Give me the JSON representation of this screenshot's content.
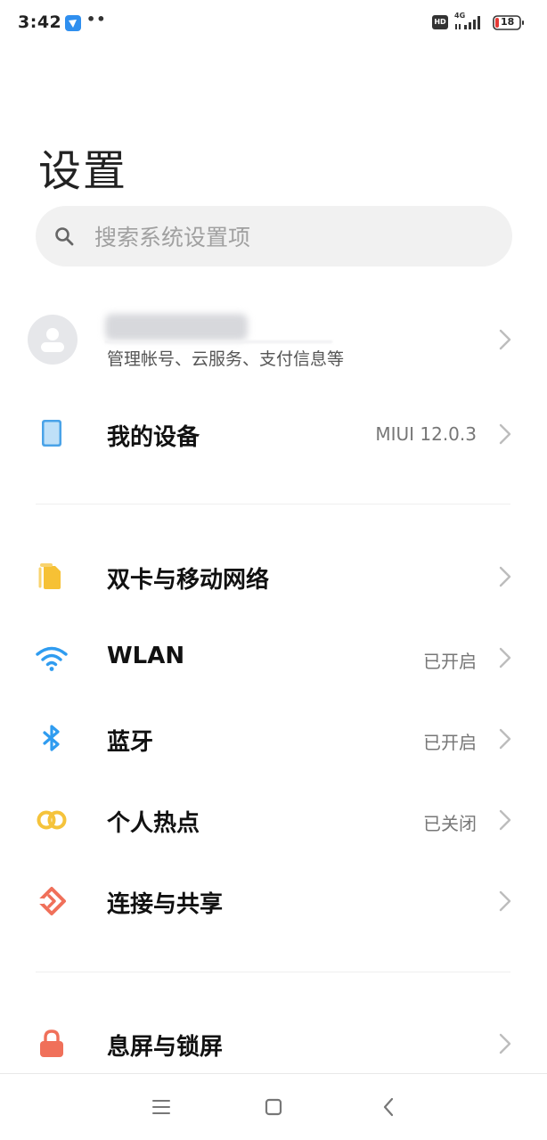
{
  "status_bar": {
    "time": "3:42",
    "app_icon": "feishu-icon",
    "dots": "••",
    "hd_label": "HD",
    "network_label": "4G",
    "battery_level": "18",
    "battery_color": "#e53935"
  },
  "page": {
    "title": "设置"
  },
  "search": {
    "placeholder": "搜索系统设置项",
    "icon": "search-icon"
  },
  "account": {
    "name_blurred": true,
    "subtitle": "管理帐号、云服务、支付信息等"
  },
  "groups": [
    {
      "items": [
        {
          "id": "my-device",
          "label": "我的设备",
          "value": "MIUI 12.0.3",
          "icon": "tablet-icon",
          "icon_color": "#4aa3e8"
        }
      ]
    },
    {
      "items": [
        {
          "id": "sim-network",
          "label": "双卡与移动网络",
          "value": "",
          "icon": "sim-card-icon",
          "icon_color": "#f6c135"
        },
        {
          "id": "wlan",
          "label": "WLAN",
          "value": "已开启",
          "icon": "wifi-icon",
          "icon_color": "#2f9cf0"
        },
        {
          "id": "bluetooth",
          "label": "蓝牙",
          "value": "已开启",
          "icon": "bluetooth-icon",
          "icon_color": "#2f9cf0"
        },
        {
          "id": "hotspot",
          "label": "个人热点",
          "value": "已关闭",
          "icon": "hotspot-icon",
          "icon_color": "#f5c33b"
        },
        {
          "id": "connect-share",
          "label": "连接与共享",
          "value": "",
          "icon": "share-icon",
          "icon_color": "#f0705a"
        }
      ]
    },
    {
      "items": [
        {
          "id": "lock-screen",
          "label": "息屏与锁屏",
          "value": "",
          "icon": "lock-icon",
          "icon_color": "#f0705a"
        }
      ]
    }
  ],
  "nav_bar": {
    "menu_icon": "menu-icon",
    "home_icon": "home-icon",
    "back_icon": "back-icon"
  }
}
